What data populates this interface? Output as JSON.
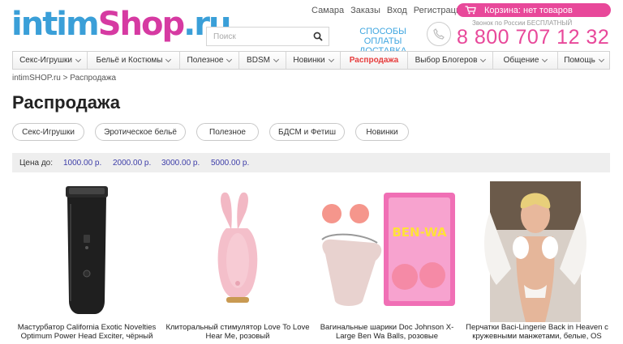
{
  "header": {
    "logo": {
      "part1": "intim",
      "part2": "Shop",
      "part3": ".ru"
    },
    "search": {
      "placeholder": "Поиск",
      "icon": "search-icon"
    },
    "links": [
      "Самара",
      "Заказы",
      "Вход",
      "Регистрация"
    ],
    "cart": {
      "label": "Корзина: нет товаров",
      "icon": "cart-icon"
    },
    "payment_link": "СПОСОБЫ ОПЛАТЫ ДОСТАВКА",
    "free_call": "Звонок по России БЕСПЛАТНЫЙ",
    "phone": "8 800 707 12 32"
  },
  "nav": [
    {
      "label": "Секс-Игрушки",
      "dropdown": true
    },
    {
      "label": "Бельё и Костюмы",
      "dropdown": true
    },
    {
      "label": "Полезное",
      "dropdown": true
    },
    {
      "label": "BDSM",
      "dropdown": true
    },
    {
      "label": "Новинки",
      "dropdown": true
    },
    {
      "label": "Распродажа",
      "dropdown": false,
      "highlight": true
    },
    {
      "label": "Выбор Блогеров",
      "dropdown": true
    },
    {
      "label": "Общение",
      "dropdown": true
    },
    {
      "label": "Помощь",
      "dropdown": true
    }
  ],
  "breadcrumb": "intimSHOP.ru > Распродажа",
  "page_title": "Распродажа",
  "categories": [
    "Секс-Игрушки",
    "Эротическое бельё",
    "Полезное",
    "БДСМ и Фетиш",
    "Новинки"
  ],
  "price_filter": {
    "label": "Цена до:",
    "options": [
      "1000.00 р.",
      "2000.00 р.",
      "3000.00 р.",
      "5000.00 р."
    ]
  },
  "products": [
    {
      "name": "Мастурбатор California Exotic Novelties Optimum Power Head Exciter, чёрный"
    },
    {
      "name": "Клиторальный стимулятор Love To Love Hear Me, розовый"
    },
    {
      "name": "Вагинальные шарики Doc Johnson X-Large Ben Wa Balls, розовые",
      "package_text": "BEN-WA"
    },
    {
      "name": "Перчатки Baci-Lingerie Back in Heaven с кружевными манжетами, белые, OS"
    }
  ],
  "colors": {
    "accent": "#e8489a",
    "logo_blue": "#3a9fd8",
    "sale_red": "#e63b3b",
    "link_blue": "#3d3da8"
  }
}
